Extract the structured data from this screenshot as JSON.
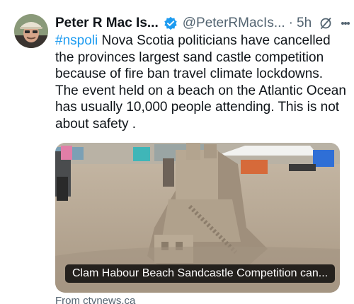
{
  "tweet": {
    "author": {
      "display_name": "Peter R Mac Is...",
      "handle": "@PeterRMacIs...",
      "verified": true
    },
    "separator": "·",
    "time": "5h",
    "hashtag": "#nspoli",
    "body": " Nova Scotia politicians have cancelled the provinces largest sand castle competition because of fire ban travel climate lockdowns. The event held on a beach on the Atlantic Ocean has usually 10,000 people attending. This is not about safety .",
    "card": {
      "title": "Clam Habour Beach Sandcastle Competition can...",
      "source": "From ctvnews.ca"
    }
  },
  "colors": {
    "text": "#0f1419",
    "secondary": "#536471",
    "accent": "#1d9bf0"
  },
  "icons": {
    "verified": "verified-badge-icon",
    "grok": "grok-icon",
    "more": "more-icon"
  }
}
